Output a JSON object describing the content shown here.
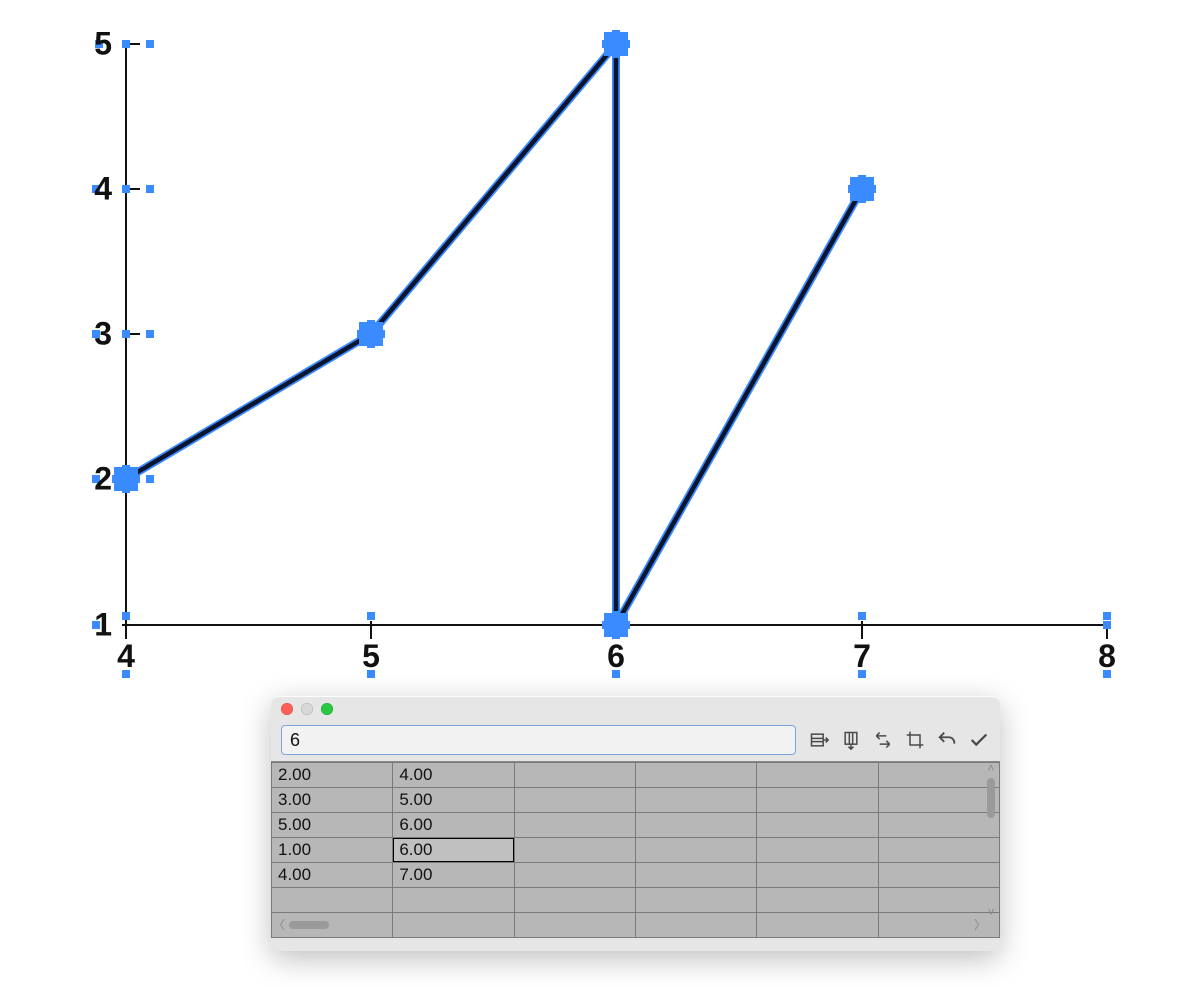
{
  "chart_data": {
    "type": "line",
    "x": [
      4,
      5,
      6,
      6,
      7
    ],
    "values": [
      2,
      3,
      5,
      1,
      4
    ],
    "xlim": [
      4,
      8
    ],
    "ylim": [
      1,
      5
    ],
    "x_ticks": [
      4,
      5,
      6,
      7,
      8
    ],
    "y_ticks": [
      1,
      2,
      3,
      4,
      5
    ],
    "title": "",
    "xlabel": "",
    "ylabel": ""
  },
  "colors": {
    "line": "#0b1530",
    "handle": "#3a8bff"
  },
  "panel": {
    "formula_value": "6",
    "active_cell": {
      "row_index": 3,
      "col_index": 1
    },
    "columns": 6,
    "empty_rows_after_data": 2,
    "rows": [
      [
        "2.00",
        "4.00"
      ],
      [
        "3.00",
        "5.00"
      ],
      [
        "5.00",
        "6.00"
      ],
      [
        "1.00",
        "6.00"
      ],
      [
        "4.00",
        "7.00"
      ]
    ]
  },
  "ticks": {
    "y": [
      "5",
      "4",
      "3",
      "2",
      "1"
    ],
    "x": [
      "4",
      "5",
      "6",
      "7",
      "8"
    ]
  }
}
